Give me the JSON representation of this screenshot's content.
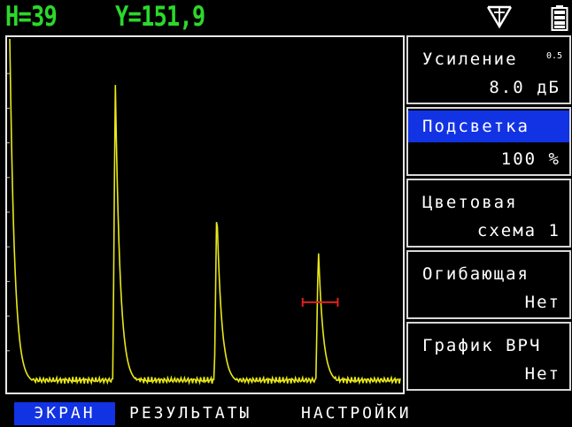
{
  "header": {
    "h_readout": "H=39",
    "y_readout": "Y=151,9",
    "probe_icon": "dual-element-probe-icon",
    "battery_icon": "battery-icon",
    "readout_color": "#2bd92b"
  },
  "menu": {
    "items": [
      {
        "label": "Усиление",
        "value": "8.0 дБ",
        "badge": "0.5",
        "selected": false
      },
      {
        "label": "Подсветка",
        "value": "100 %",
        "selected": true
      },
      {
        "label": "Цветовая",
        "value": "схема 1",
        "selected": false
      },
      {
        "label": "Огибающая",
        "value": "Нет",
        "selected": false
      },
      {
        "label": "График ВРЧ",
        "value": "Нет",
        "selected": false
      }
    ],
    "selected_color": "#1233e4"
  },
  "tabs": [
    {
      "label": "ЭКРАН",
      "active": true
    },
    {
      "label": "РЕЗУЛЬТАТЫ",
      "active": false
    },
    {
      "label": "НАСТРОЙКИ",
      "active": false
    }
  ],
  "ascan": {
    "trace_color": "#e8e81a",
    "gate_color": "#e02020",
    "peaks": [
      {
        "position": 0.0,
        "amplitude": 1.0
      },
      {
        "position": 0.27,
        "amplitude": 0.88
      },
      {
        "position": 0.53,
        "amplitude": 0.51
      },
      {
        "position": 0.79,
        "amplitude": 0.39
      }
    ],
    "gate": {
      "start": 0.75,
      "end": 0.84,
      "level": 0.24
    }
  }
}
